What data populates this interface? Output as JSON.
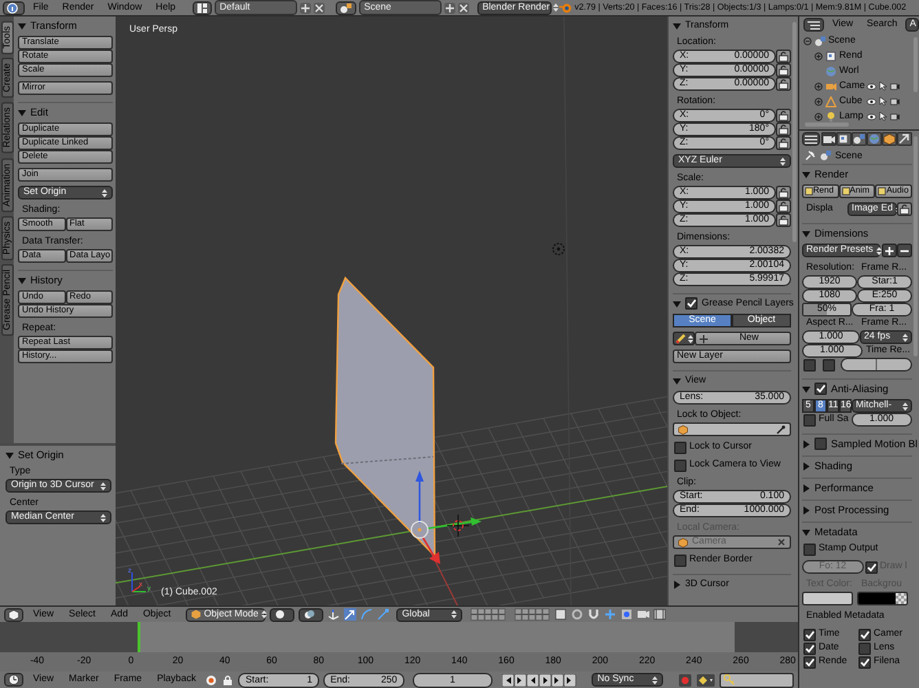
{
  "top_bar": {
    "menus": [
      "File",
      "Render",
      "Window",
      "Help"
    ],
    "layout": "Default",
    "scene": "Scene",
    "engine": "Blender Render",
    "stats": "v2.79 | Verts:20 | Faces:16 | Tris:28 | Objects:1/3 | Lamps:0/1 | Mem:9.81M | Cube.002"
  },
  "tool_tabs": [
    {
      "label": "Tools",
      "selected": true
    },
    {
      "label": "Create",
      "selected": false
    },
    {
      "label": "Relations",
      "selected": false
    },
    {
      "label": "Animation",
      "selected": false
    },
    {
      "label": "Physics",
      "selected": false
    },
    {
      "label": "Grease Pencil",
      "selected": false
    }
  ],
  "tool_shelf": {
    "panels": [
      {
        "title": "Transform",
        "expanded": true,
        "groups": [
          [
            [
              {
                "kind": "button",
                "label": "Translate"
              }
            ],
            [
              {
                "kind": "button",
                "label": "Rotate"
              }
            ],
            [
              {
                "kind": "button",
                "label": "Scale"
              }
            ]
          ],
          [
            [
              {
                "kind": "button",
                "label": "Mirror"
              }
            ]
          ]
        ]
      },
      {
        "title": "Edit",
        "expanded": true,
        "groups": [
          [
            [
              {
                "kind": "button",
                "label": "Duplicate"
              }
            ],
            [
              {
                "kind": "button",
                "label": "Duplicate Linked"
              }
            ],
            [
              {
                "kind": "button",
                "label": "Delete"
              }
            ]
          ],
          [
            [
              {
                "kind": "button",
                "label": "Join"
              }
            ]
          ],
          [
            [
              {
                "kind": "dropdown",
                "text": "Set Origin"
              }
            ]
          ],
          [
            [
              {
                "kind": "label",
                "text": "Shading:"
              }
            ],
            [
              {
                "kind": "button",
                "label": "Smooth"
              },
              {
                "kind": "button",
                "label": "Flat"
              }
            ]
          ],
          [
            [
              {
                "kind": "label",
                "text": "Data Transfer:"
              }
            ],
            [
              {
                "kind": "button",
                "label": "Data"
              },
              {
                "kind": "button",
                "label": "Data Layo"
              }
            ]
          ]
        ]
      },
      {
        "title": "History",
        "expanded": true,
        "groups": [
          [
            [
              {
                "kind": "button",
                "label": "Undo"
              },
              {
                "kind": "button",
                "label": "Redo"
              }
            ],
            [
              {
                "kind": "button",
                "label": "Undo History"
              }
            ]
          ],
          [
            [
              {
                "kind": "label",
                "text": "Repeat:"
              }
            ],
            [
              {
                "kind": "button",
                "label": "Repeat Last"
              }
            ],
            [
              {
                "kind": "button",
                "label": "History..."
              }
            ]
          ]
        ]
      }
    ]
  },
  "operator_panel": {
    "panels": [
      {
        "title": "Set Origin",
        "expanded": true,
        "groups": [
          [
            [
              {
                "kind": "label",
                "text": "Type"
              }
            ],
            [
              {
                "kind": "dropdown",
                "text": "Origin to 3D Cursor"
              }
            ]
          ],
          [
            [
              {
                "kind": "label",
                "text": "Center"
              }
            ],
            [
              {
                "kind": "dropdown",
                "text": "Median Center"
              }
            ]
          ]
        ]
      }
    ]
  },
  "viewport": {
    "view_name": "User Persp",
    "object_label": "(1) Cube.002",
    "axes": [
      "z",
      "x",
      "y"
    ]
  },
  "n_panel": {
    "panels": [
      {
        "title": "Transform",
        "expanded": true,
        "groups": [
          [
            [
              {
                "kind": "label",
                "text": "Location:"
              }
            ],
            [
              {
                "kind": "num",
                "label": "X:",
                "value": "0.00000"
              },
              {
                "kind": "lock"
              }
            ],
            [
              {
                "kind": "num",
                "label": "Y:",
                "value": "0.00000"
              },
              {
                "kind": "lock"
              }
            ],
            [
              {
                "kind": "num",
                "label": "Z:",
                "value": "0.00000"
              },
              {
                "kind": "lock"
              }
            ]
          ],
          [
            [
              {
                "kind": "label",
                "text": "Rotation:"
              }
            ],
            [
              {
                "kind": "num",
                "label": "X:",
                "value": "0°"
              },
              {
                "kind": "lock"
              }
            ],
            [
              {
                "kind": "num",
                "label": "Y:",
                "value": "180°"
              },
              {
                "kind": "lock"
              }
            ],
            [
              {
                "kind": "num",
                "label": "Z:",
                "value": "0°"
              },
              {
                "kind": "lock"
              }
            ]
          ],
          [
            [
              {
                "kind": "dropdown",
                "text": "XYZ Euler"
              }
            ]
          ],
          [
            [
              {
                "kind": "label",
                "text": "Scale:"
              }
            ],
            [
              {
                "kind": "num",
                "label": "X:",
                "value": "1.000"
              },
              {
                "kind": "lock"
              }
            ],
            [
              {
                "kind": "num",
                "label": "Y:",
                "value": "1.000"
              },
              {
                "kind": "lock"
              }
            ],
            [
              {
                "kind": "num",
                "label": "Z:",
                "value": "1.000"
              },
              {
                "kind": "lock"
              }
            ]
          ],
          [
            [
              {
                "kind": "label",
                "text": "Dimensions:"
              }
            ],
            [
              {
                "kind": "num",
                "label": "X:",
                "value": "2.00382"
              }
            ],
            [
              {
                "kind": "num",
                "label": "Y:",
                "value": "2.00104"
              }
            ],
            [
              {
                "kind": "num",
                "label": "Z:",
                "value": "5.99917"
              }
            ]
          ]
        ]
      },
      {
        "title": "Grease Pencil Layers",
        "expanded": true,
        "checked": true,
        "groups": [
          [
            [
              {
                "kind": "tab",
                "label": "Scene",
                "selected": true
              },
              {
                "kind": "tab",
                "label": "Object",
                "selected": false
              }
            ]
          ],
          [
            [
              {
                "kind": "pencil"
              },
              {
                "kind": "new",
                "label": "New"
              }
            ]
          ],
          [
            [
              {
                "kind": "button",
                "label": "New Layer"
              }
            ]
          ]
        ]
      },
      {
        "title": "View",
        "expanded": true,
        "groups": [
          [
            [
              {
                "kind": "num",
                "label": "Lens:",
                "value": "35.000"
              }
            ]
          ],
          [
            [
              {
                "kind": "label",
                "text": "Lock to Object:"
              }
            ],
            [
              {
                "kind": "objfield"
              }
            ]
          ],
          [
            [
              {
                "kind": "check",
                "text": "Lock to Cursor",
                "checked": false
              }
            ]
          ],
          [
            [
              {
                "kind": "check",
                "text": "Lock Camera to View",
                "checked": false
              }
            ]
          ],
          [
            [
              {
                "kind": "label",
                "text": "Clip:"
              }
            ],
            [
              {
                "kind": "num",
                "label": "Start:",
                "value": "0.100"
              }
            ],
            [
              {
                "kind": "num",
                "label": "End:",
                "value": "1000.000"
              }
            ]
          ],
          [
            [
              {
                "kind": "label",
                "text": "Local Camera:",
                "disabled": true
              }
            ],
            [
              {
                "kind": "objfield",
                "text": "Camera",
                "disabled": true
              }
            ]
          ],
          [
            [
              {
                "kind": "check",
                "text": "Render Border",
                "checked": false
              }
            ]
          ]
        ]
      },
      {
        "title": "3D Cursor",
        "expanded": false
      }
    ]
  },
  "view_header": {
    "menus": [
      "View",
      "Select",
      "Add",
      "Object"
    ],
    "mode": "Object Mode",
    "orientation": "Global"
  },
  "outliner": {
    "menus": [
      "View",
      "Search"
    ],
    "filter": "A",
    "tree": [
      {
        "label": "Scene",
        "kind": "scene",
        "expanded": true,
        "children": [
          {
            "label": "Rend",
            "kind": "layers",
            "expanded": false
          },
          {
            "label": "Worl",
            "kind": "world"
          },
          {
            "label": "Came",
            "kind": "camera",
            "expanded": false
          },
          {
            "label": "Cube",
            "kind": "mesh",
            "expanded": false
          },
          {
            "label": "Lamp",
            "kind": "lamp",
            "expanded": false
          }
        ]
      }
    ]
  },
  "properties": {
    "context_tabs": [
      {
        "selected": true
      },
      {
        "selected": false
      },
      {
        "selected": false
      },
      {
        "selected": false
      },
      {
        "selected": false
      },
      {
        "selected": false
      }
    ],
    "context": "Scene",
    "panels": [
      {
        "title": "Render",
        "expanded": true,
        "groups": [
          [
            [
              {
                "kind": "ibutton",
                "label": "Rend"
              },
              {
                "kind": "ibutton",
                "label": "Anim"
              },
              {
                "kind": "ibutton",
                "label": "Audio"
              }
            ]
          ],
          [
            [
              {
                "kind": "label",
                "text": "Displa"
              },
              {
                "kind": "dropdown",
                "text": "Image Ed"
              },
              {
                "kind": "lock"
              }
            ]
          ]
        ]
      },
      {
        "title": "Dimensions",
        "expanded": true,
        "groups": [
          [
            [
              {
                "kind": "dropdown",
                "text": "Render Presets"
              },
              {
                "kind": "add"
              },
              {
                "kind": "remove"
              }
            ]
          ],
          [
            [
              {
                "kind": "label",
                "text": "Resolution:"
              },
              {
                "kind": "label",
                "text": "Frame R..."
              }
            ],
            [
              {
                "kind": "num",
                "value": "1920"
              },
              {
                "kind": "num",
                "value": "Star:1"
              }
            ],
            [
              {
                "kind": "num",
                "value": "1080"
              },
              {
                "kind": "num",
                "value": "E:250"
              }
            ],
            [
              {
                "kind": "slider",
                "value": "50%",
                "level": 0.5
              },
              {
                "kind": "num",
                "value": "Fra: 1"
              }
            ],
            [
              {
                "kind": "label",
                "text": "Aspect R..."
              },
              {
                "kind": "label",
                "text": "Frame R..."
              }
            ],
            [
              {
                "kind": "num",
                "value": "1.000"
              },
              {
                "kind": "dropdown",
                "text": "24 fps"
              }
            ],
            [
              {
                "kind": "num",
                "value": "1.000"
              },
              {
                "kind": "label",
                "text": "Time Re..."
              }
            ],
            [
              {
                "kind": "check",
                "checked": false
              },
              {
                "kind": "check",
                "checked": false
              },
              {
                "kind": "splitnum"
              }
            ]
          ]
        ]
      },
      {
        "title": "Anti-Aliasing",
        "expanded": true,
        "checked": true,
        "groups": [
          [
            [
              {
                "kind": "tab",
                "label": "5",
                "selected": false
              },
              {
                "kind": "tab",
                "label": "8",
                "selected": true
              },
              {
                "kind": "tab",
                "label": "11",
                "selected": false
              },
              {
                "kind": "tab",
                "label": "16",
                "selected": false
              },
              {
                "kind": "dropdown",
                "text": "Mitchell-"
              }
            ],
            [
              {
                "kind": "check",
                "text": "Full Sa",
                "checked": false
              },
              {
                "kind": "num",
                "value": "1.000"
              }
            ]
          ]
        ]
      },
      {
        "title": "Sampled Motion Bl",
        "expanded": false,
        "checked": false
      },
      {
        "title": "Shading",
        "expanded": false
      },
      {
        "title": "Performance",
        "expanded": false
      },
      {
        "title": "Post Processing",
        "expanded": false
      },
      {
        "title": "Metadata",
        "expanded": true,
        "groups": [
          [
            [
              {
                "kind": "check",
                "text": "Stamp Output",
                "checked": false
              }
            ]
          ],
          [
            [
              {
                "kind": "num",
                "value": "Fo: 12",
                "disabled": true
              },
              {
                "kind": "check",
                "text": "Draw l",
                "checked": true,
                "disabled": true
              }
            ]
          ],
          [
            [
              {
                "kind": "label",
                "text": "Text Color:",
                "disabled": true
              },
              {
                "kind": "label",
                "text": "Backgrou",
                "disabled": true
              }
            ],
            [
              {
                "kind": "swatch",
                "color": "#c8c8c8"
              },
              {
                "kind": "swatch",
                "color": "#000000"
              }
            ]
          ],
          [
            [
              {
                "kind": "label",
                "text": "Enabled Metadata"
              }
            ]
          ],
          [
            [
              {
                "kind": "check",
                "text": "Time",
                "checked": true
              },
              {
                "kind": "check",
                "text": "Camer",
                "checked": true
              }
            ],
            [
              {
                "kind": "check",
                "text": "Date",
                "checked": true
              },
              {
                "kind": "check",
                "text": "Lens",
                "checked": false
              }
            ],
            [
              {
                "kind": "check",
                "text": "Rende",
                "checked": true
              },
              {
                "kind": "check",
                "text": "Filena",
                "checked": true
              }
            ]
          ]
        ]
      }
    ]
  },
  "timeline": {
    "ruler": [
      "-40",
      "-20",
      "0",
      "20",
      "40",
      "60",
      "80",
      "100",
      "120",
      "140",
      "160",
      "180",
      "200",
      "220",
      "240",
      "260",
      "280"
    ],
    "menus": [
      "View",
      "Marker",
      "Frame",
      "Playback"
    ],
    "start": {
      "label": "Start:",
      "value": "1"
    },
    "end": {
      "label": "End:",
      "value": "250"
    },
    "current": "1",
    "sync": "No Sync"
  }
}
